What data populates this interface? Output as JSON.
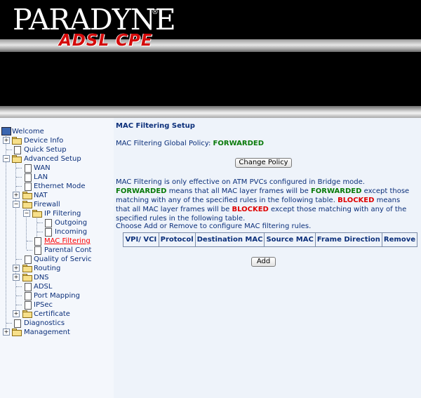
{
  "header": {
    "brand": "PARADYNE",
    "product": "ADSL CPE"
  },
  "sidebar": {
    "items": [
      {
        "label": "Welcome"
      },
      {
        "label": "Device Info"
      },
      {
        "label": "Quick Setup"
      },
      {
        "label": "Advanced Setup"
      },
      {
        "label": "WAN"
      },
      {
        "label": "LAN"
      },
      {
        "label": "Ethernet Mode"
      },
      {
        "label": "NAT"
      },
      {
        "label": "Firewall"
      },
      {
        "label": "IP Filtering"
      },
      {
        "label": "Outgoing"
      },
      {
        "label": "Incoming"
      },
      {
        "label": "MAC Filtering"
      },
      {
        "label": "Parental Cont"
      },
      {
        "label": "Quality of Servic"
      },
      {
        "label": "Routing"
      },
      {
        "label": "DNS"
      },
      {
        "label": "ADSL"
      },
      {
        "label": "Port Mapping"
      },
      {
        "label": "IPSec"
      },
      {
        "label": "Certificate"
      },
      {
        "label": "Diagnostics"
      },
      {
        "label": "Management"
      }
    ]
  },
  "main": {
    "title": "MAC Filtering Setup",
    "policy_label": "MAC Filtering Global Policy:",
    "policy_value": "FORWARDED",
    "change_policy_button": "Change Policy",
    "desc": {
      "p1": "MAC Filtering is only effective on ATM PVCs configured in Bridge mode.",
      "forwarded1": "FORWARDED",
      "p2": "means that all MAC layer frames will be",
      "forwarded2": "FORWARDED",
      "p3": "except those matching with any of the specified rules in the following table.",
      "blocked1": "BLOCKED",
      "p4": "means that all MAC layer frames will be",
      "blocked2": "BLOCKED",
      "p5": "except those matching with any of the specified rules in the following table."
    },
    "choose_text": "Choose Add or Remove to configure MAC filtering rules.",
    "table": {
      "columns": [
        "VPI/ VCI",
        "Protocol",
        "Destination MAC",
        "Source MAC",
        "Frame Direction",
        "Remove"
      ]
    },
    "add_button": "Add"
  },
  "colors": {
    "text": "#0b2f7a",
    "forwarded": "#0a7a0a",
    "blocked": "#e00000",
    "active_link": "#ff0000",
    "page_bg": "#eef3fa"
  }
}
